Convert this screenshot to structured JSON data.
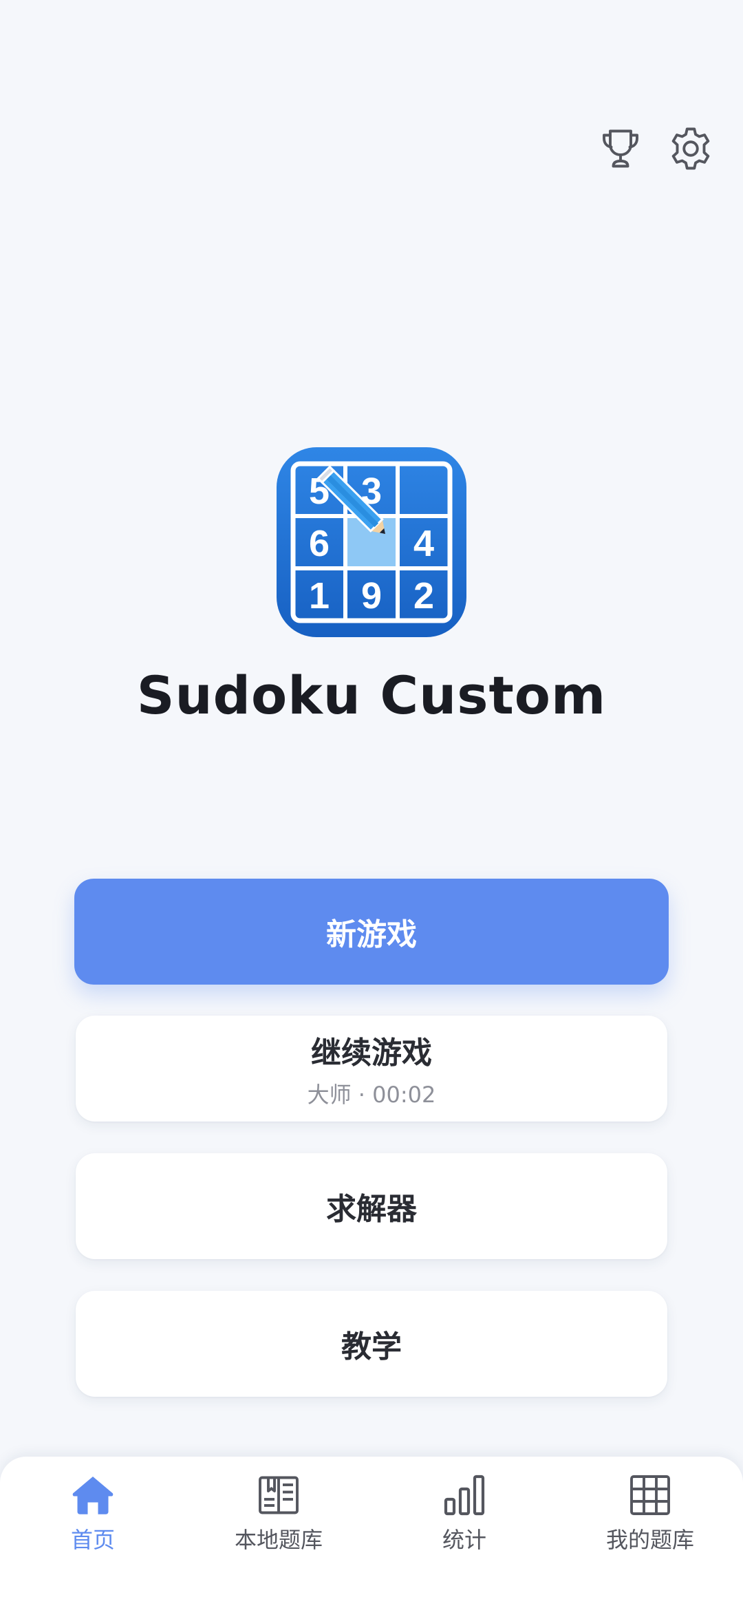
{
  "app": {
    "title": "Sudoku Custom",
    "logo_digits": [
      "5",
      "3",
      "6",
      "4",
      "1",
      "9",
      "2"
    ]
  },
  "header": {
    "trophy_icon": "trophy-icon",
    "settings_icon": "gear-icon"
  },
  "menu": {
    "new_game": "新游戏",
    "continue_game": "继续游戏",
    "continue_detail": "大师 · 00:02",
    "solver": "求解器",
    "tutorial": "教学"
  },
  "tabs": [
    {
      "label": "首页",
      "icon": "home-icon",
      "active": true
    },
    {
      "label": "本地题库",
      "icon": "book-icon",
      "active": false
    },
    {
      "label": "统计",
      "icon": "bar-chart-icon",
      "active": false
    },
    {
      "label": "我的题库",
      "icon": "grid-icon",
      "active": false
    }
  ],
  "colors": {
    "accent": "#5e8bef",
    "background": "#f5f7fb",
    "logo_blue": "#1f6fd4",
    "icon_gray": "#54565e"
  }
}
